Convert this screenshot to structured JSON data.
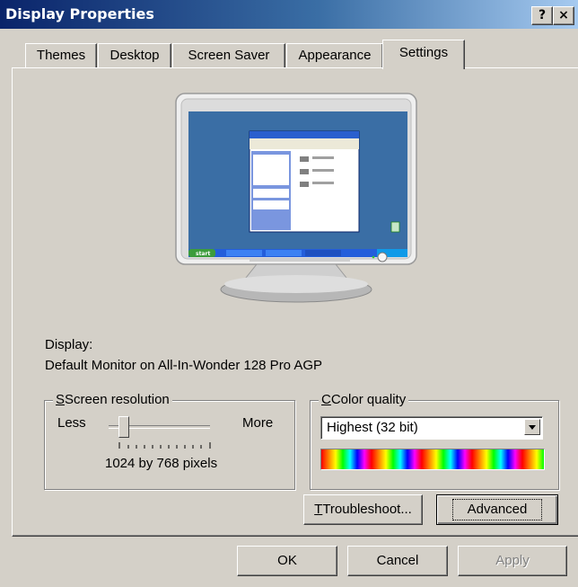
{
  "window": {
    "title": "Display Properties",
    "help_button": "?",
    "close_button": "×"
  },
  "tabs": [
    {
      "label": "Themes"
    },
    {
      "label": "Desktop"
    },
    {
      "label": "Screen Saver"
    },
    {
      "label": "Appearance"
    },
    {
      "label": "Settings",
      "active": true
    }
  ],
  "display": {
    "label": "Display:",
    "device": "Default Monitor on All-In-Wonder 128 Pro AGP"
  },
  "resolution": {
    "group_title": "Screen resolution",
    "less_label": "Less",
    "more_label": "More",
    "value_text": "1024 by 768 pixels",
    "slider_position": 0.0
  },
  "color_quality": {
    "group_title": "Color quality",
    "selected": "Highest (32 bit)"
  },
  "buttons": {
    "troubleshoot": "Troubleshoot...",
    "advanced": "Advanced",
    "ok": "OK",
    "cancel": "Cancel",
    "apply": "Apply"
  },
  "preview": {
    "start_label": "start",
    "desktop_color": "#3a6ea5"
  }
}
